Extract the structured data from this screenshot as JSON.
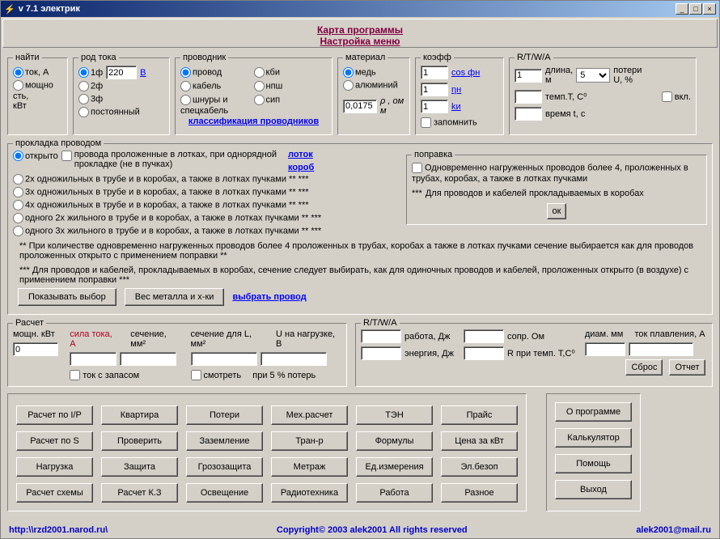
{
  "title": "v 7.1 электрик",
  "toolbar_links": {
    "map": "Карта программы",
    "menu": "Настройка меню"
  },
  "find": {
    "legend": "найти",
    "opt_current": "ток, А",
    "opt_power": "мощно\nсть,\nкВт"
  },
  "rod": {
    "legend": "род тока",
    "o1": "1ф",
    "o2": "2ф",
    "o3": "3ф",
    "o4": "постоянный",
    "voltage": "220",
    "unit": "В"
  },
  "prov": {
    "legend": "проводник",
    "o1": "провод",
    "o2": "кабель",
    "o3": "шнуры и\nспецкабель",
    "o4": "кби",
    "o5": "нпш",
    "o6": "сип",
    "link": "классификация проводников"
  },
  "mat": {
    "legend": "материал",
    "o1": "медь",
    "o2": "алюминий",
    "rho": "0,0175",
    "rho_label": "ρ , ом м"
  },
  "koef": {
    "legend": "коэфф",
    "v1": "1",
    "v2": "1",
    "v3": "1",
    "l1": "cos фн",
    "l2": "ηн",
    "l3": "kи",
    "remember": "запомнить"
  },
  "rtwa": {
    "legend": "R/T/W/A",
    "len": "1",
    "len_lbl": "длина,\nм",
    "sel": "5",
    "loss_lbl": "потери\nU, %",
    "temp_lbl": "темп.T, С⁰",
    "incl": "вкл.",
    "time_lbl": "время t, с"
  },
  "prokl": {
    "legend": "прокладка проводом",
    "open": "открыто",
    "open_note": "провода проложенные в лотках, при однорядной\nпрокладке (не в пучках)",
    "o1": "2х одножильных в трубе и в коробах, а также в лотках пучками ** ***",
    "o2": "3х одножильных в трубе и в коробах, а также в лотках пучками ** ***",
    "o3": "4х одножильных в трубе и в коробах, а также в лотках пучками ** ***",
    "o4": "одного 2х жильного в трубе и в коробах, а также в лотках пучками ** ***",
    "o5": "одного 3х жильного в трубе и в коробах, а также в лотках пучками ** ***",
    "links": {
      "lotok": "лоток",
      "korob": "короб"
    }
  },
  "popravka": {
    "legend": "поправка",
    "c1": "Одновременно нагруженных проводов более 4, проложенных в\nтрубах, коробах, а также в лотках пучками",
    "c2_prefix": "***",
    "c2": "Для проводов и кабелей прокладываемых в коробах",
    "ok": "ок"
  },
  "notes": {
    "n1_prefix": "**",
    "n1": "При количестве одновременно нагруженных проводов более 4 проложенных в трубах, коробах а также в лотках пучками сечение выбирается как для проводов проложенных открыто с применением поправки **",
    "n2_prefix": "***",
    "n2": "Для проводов и кабелей, прокладываемых в коробах, сечение следует выбирать, как для одиночных проводов и кабелей, проложенных открыто (в воздухе) с применением поправки ***"
  },
  "actions": {
    "show": "Показывать выбор",
    "weight": "Вес металла и х-ки",
    "choose": "выбрать провод"
  },
  "calc": {
    "legend": "Расчет",
    "power_lbl": "мощн. кВт",
    "power_val": "0",
    "current_lbl": "сила тока, А",
    "section_lbl": "сечение, мм²",
    "reserve": "ток с запасом",
    "sectionL_lbl": "сечение для L, мм²",
    "voltageL_lbl": "U на нагрузке, В",
    "watch": "смотреть",
    "loss5": "при 5 % потерь"
  },
  "rtwa2": {
    "legend": "R/T/W/A",
    "work": "работа, Дж",
    "energy": "энергия, Дж",
    "res": "сопр. Ом",
    "r_temp": "R при темп. T,C⁰",
    "diam": "диам. мм",
    "melt": "ток плавления, А",
    "reset": "Сброс",
    "report": "Отчет"
  },
  "buttons": [
    "Расчет по I/P",
    "Квартира",
    "Потери",
    "Мех.расчет",
    "ТЭН",
    "Прайс",
    "Расчет по S",
    "Проверить",
    "Заземление",
    "Тран-р",
    "Формулы",
    "Цена за кВт",
    "Нагрузка",
    "Защита",
    "Грозозащита",
    "Метраж",
    "Ед.измерения",
    "Эл.безоп",
    "Расчет схемы",
    "Расчет К.З",
    "Освещение",
    "Радиотехника",
    "Работа",
    "Разное"
  ],
  "rbuttons": [
    "О программе",
    "Калькулятор",
    "Помощь",
    "Выход"
  ],
  "status": {
    "l": "http:\\\\rzd2001.narod.ru\\",
    "c": "Copyright© 2003 alek2001 All rights reserved",
    "r": "alek2001@mail.ru"
  }
}
